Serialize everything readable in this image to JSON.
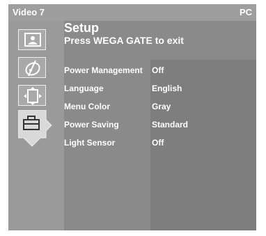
{
  "topbar": {
    "source": "Video 7",
    "mode": "PC"
  },
  "header": {
    "title": "Setup",
    "subtitle": "Press WEGA GATE to exit"
  },
  "sidebar": {
    "icons": [
      "picture-icon",
      "sound-icon",
      "screen-icon",
      "setup-icon"
    ],
    "selected": "setup-icon"
  },
  "settings": [
    {
      "label": "Power Management",
      "value": "Off"
    },
    {
      "label": "Language",
      "value": "English"
    },
    {
      "label": "Menu Color",
      "value": "Gray"
    },
    {
      "label": "Power Saving",
      "value": "Standard"
    },
    {
      "label": "Light Sensor",
      "value": "Off"
    }
  ],
  "colors": {
    "panel": "#8a8a8a",
    "value_column": "#7e7e7e",
    "text": "#ffffff"
  }
}
